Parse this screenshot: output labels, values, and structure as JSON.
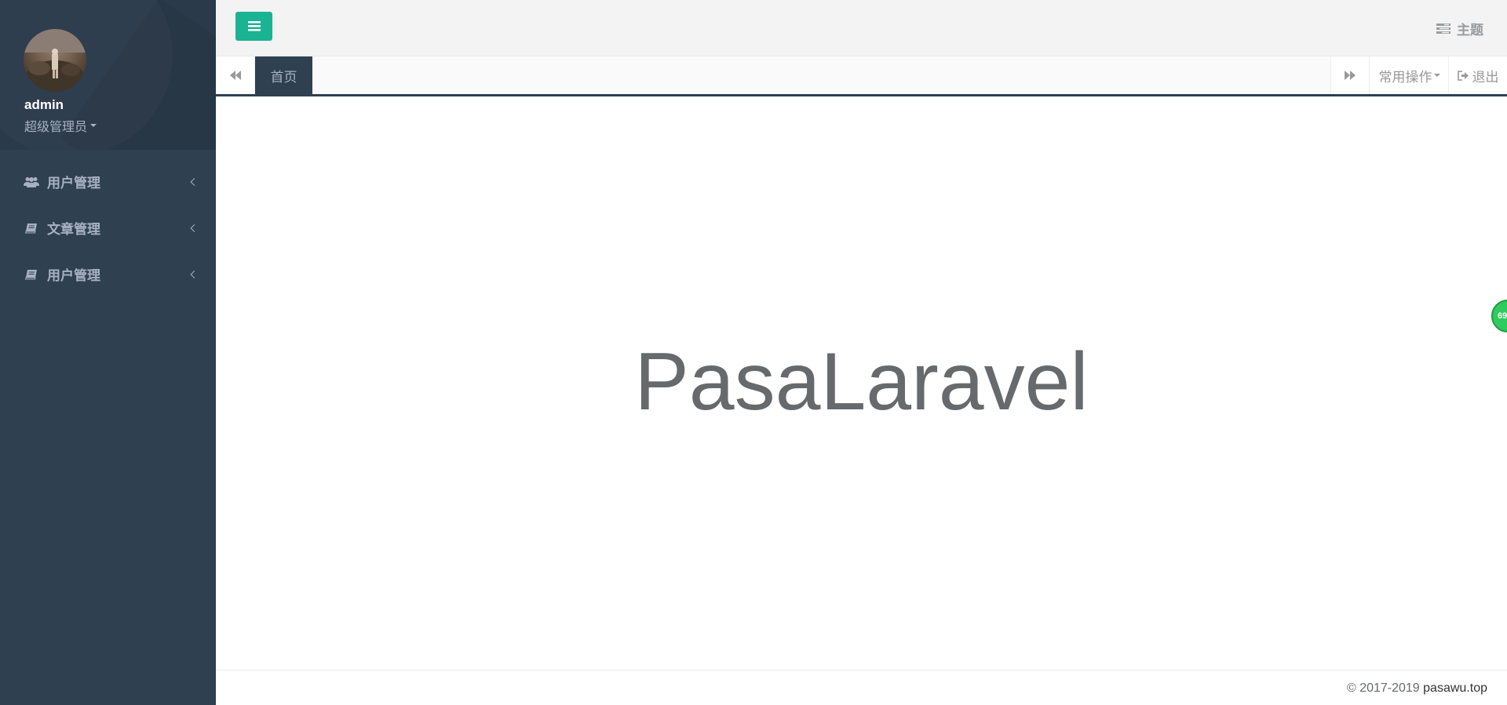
{
  "profile": {
    "name": "admin",
    "role": "超级管理员"
  },
  "sidebar": {
    "items": [
      {
        "label": "用户管理",
        "icon": "users-icon"
      },
      {
        "label": "文章管理",
        "icon": "book-icon"
      },
      {
        "label": "用户管理",
        "icon": "book-icon"
      }
    ]
  },
  "header": {
    "theme_label": "主题",
    "menu_toggle_icon": "bars-icon"
  },
  "tabs": {
    "home_label": "首页",
    "ops_label": "常用操作",
    "logout_label": "退出"
  },
  "main": {
    "title": "PasaLaravel"
  },
  "footer": {
    "copyright": "© 2017-2019",
    "site": "pasawu.top"
  },
  "float_badge": {
    "text": "69"
  },
  "colors": {
    "sidebar_bg": "#2f4050",
    "accent": "#1ab394",
    "text_muted": "#a7b1c2",
    "title_text": "#676a6c"
  }
}
